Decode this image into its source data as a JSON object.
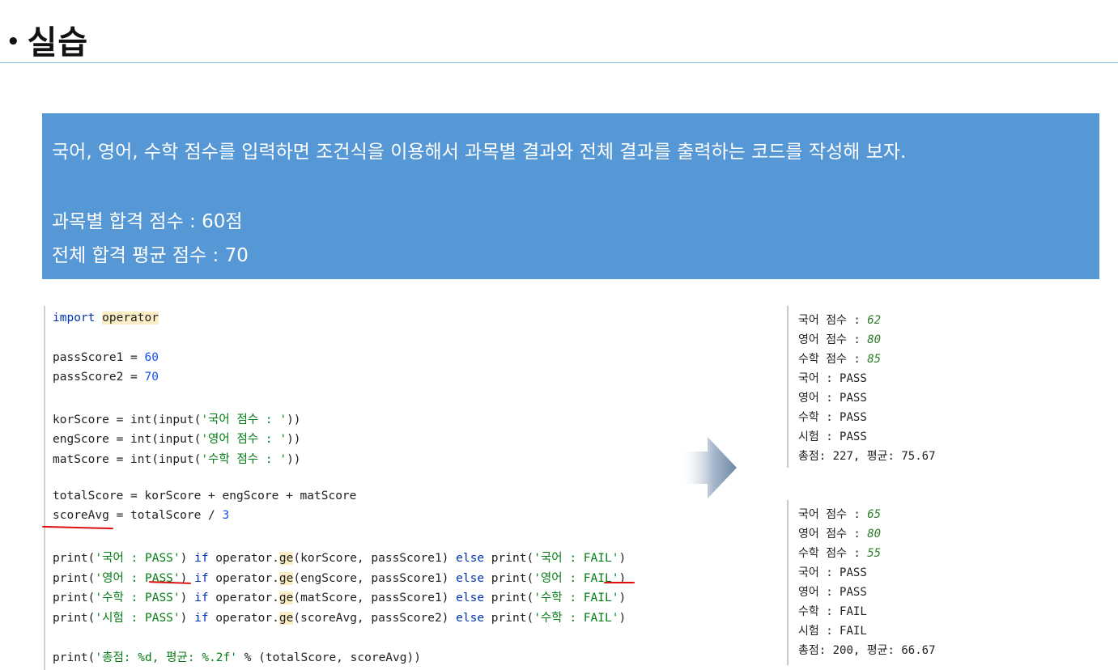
{
  "slide": {
    "bullet": "•",
    "title": "실습"
  },
  "task": {
    "description": "국어, 영어, 수학 점수를 입력하면 조건식을 이용해서 과목별 결과와 전체 결과를 출력하는 코드를 작성해 보자.",
    "subject_pass": "과목별 합격 점수 : 60점",
    "total_pass": "전체 합격 평균 점수 : 70"
  },
  "code": {
    "l1_kw": "import",
    "l1_mod": "operator",
    "l2_a": "passScore1 = ",
    "l2_n": "60",
    "l3_a": "passScore2 = ",
    "l3_n": "70",
    "l4_a": "korScore = int(input(",
    "l4_s": "'국어 점수 : '",
    "l4_b": "))",
    "l5_a": "engScore = int(input(",
    "l5_s": "'영어 점수 : '",
    "l5_b": "))",
    "l6_a": "matScore = int(input(",
    "l6_s": "'수학 점수 : '",
    "l6_b": "))",
    "l7": "totalScore = korScore + engScore + matScore",
    "l8_a": "scoreAvg = totalScore / ",
    "l8_n": "3",
    "p1_s1": "'국어 : PASS'",
    "p1_s2": "'국어 : FAIL'",
    "p1_args": "(korScore, passScore1) ",
    "p2_s1": "'영어 : PASS'",
    "p2_s2": "'영어 : FAIL'",
    "p2_args": "(engScore, passScore1) ",
    "p3_s1": "'수학 : PASS'",
    "p3_s2": "'수학 : FAIL'",
    "p3_args": "(matScore, passScore1) ",
    "p4_s1": "'시험 : PASS'",
    "p4_s2": "'수학 : FAIL'",
    "p4_args": "(scoreAvg, passScore2) ",
    "print": "print(",
    "close_if": ") ",
    "if": "if",
    "op": " operator.",
    "ge": "ge",
    "else": "else",
    "print2": " print(",
    "close": ")",
    "last_s": "'총점: %d, 평균: %.2f'",
    "last_b": " % (totalScore, scoreAvg))"
  },
  "output1": {
    "kor_label": "국어 점수 : ",
    "kor_val": "62",
    "eng_label": "영어 점수 : ",
    "eng_val": "80",
    "mat_label": "수학 점수 : ",
    "mat_val": "85",
    "r1": "국어 : PASS",
    "r2": "영어 : PASS",
    "r3": "수학 : PASS",
    "r4": "시험 : PASS",
    "sum": "총점: 227, 평균: 75.67"
  },
  "output2": {
    "kor_label": "국어 점수 : ",
    "kor_val": "65",
    "eng_label": "영어 점수 : ",
    "eng_val": "80",
    "mat_label": "수학 점수 : ",
    "mat_val": "55",
    "r1": "국어 : PASS",
    "r2": "영어 : PASS",
    "r3": "수학 : FAIL",
    "r4": "시험 : FAIL",
    "sum": "총점: 200, 평균: 66.67"
  },
  "colors": {
    "banner": "#5698d6",
    "keyword": "#0033b3",
    "string": "#067d17",
    "number": "#1750eb",
    "annotation": "#dd1111"
  }
}
